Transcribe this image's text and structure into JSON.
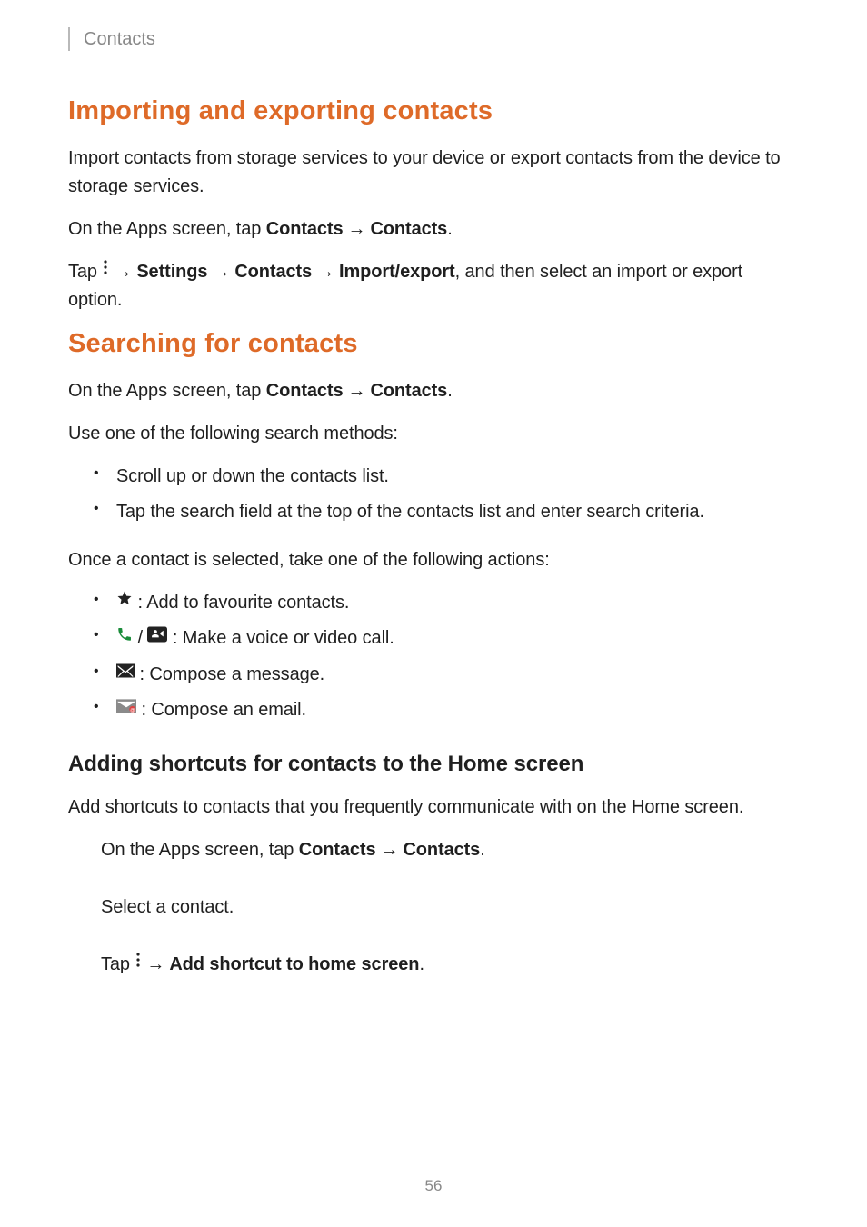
{
  "header": {
    "crumb": "Contacts"
  },
  "section_import_export": {
    "title": "Importing and exporting contacts",
    "intro": "Import contacts from storage services to your device or export contacts from the device to storage services.",
    "nav_line": {
      "prefix": "On the Apps screen, tap ",
      "bold1": "Contacts",
      "bold2": "Contacts",
      "suffix": "."
    },
    "tap_line": {
      "prefix": "Tap ",
      "bold1": "Settings",
      "bold2": "Contacts",
      "bold3": "Import/export",
      "suffix": ", and then select an import or export option."
    }
  },
  "section_search": {
    "title": "Searching for contacts",
    "nav_line": {
      "prefix": "On the Apps screen, tap ",
      "bold1": "Contacts",
      "bold2": "Contacts",
      "suffix": "."
    },
    "method_intro": "Use one of the following search methods:",
    "method_items": [
      "Scroll up or down the contacts list.",
      "Tap the search field at the top of the contacts list and enter search criteria."
    ],
    "action_intro": "Once a contact is selected, take one of the following actions:",
    "action_items": {
      "fav": " : Add to favourite contacts.",
      "call_sep": " / ",
      "call": " : Make a voice or video call.",
      "msg": " : Compose a message.",
      "email": " : Compose an email."
    }
  },
  "subsection_shortcut": {
    "title": "Adding shortcuts for contacts to the Home screen",
    "intro": "Add shortcuts to contacts that you frequently communicate with on the Home screen.",
    "step1": {
      "prefix": "On the Apps screen, tap ",
      "bold1": "Contacts",
      "bold2": "Contacts",
      "suffix": "."
    },
    "step2": "Select a contact.",
    "step3": {
      "prefix": "Tap ",
      "bold": "Add shortcut to home screen",
      "suffix": "."
    }
  },
  "page_number": "56",
  "arrow_glyph": "→"
}
